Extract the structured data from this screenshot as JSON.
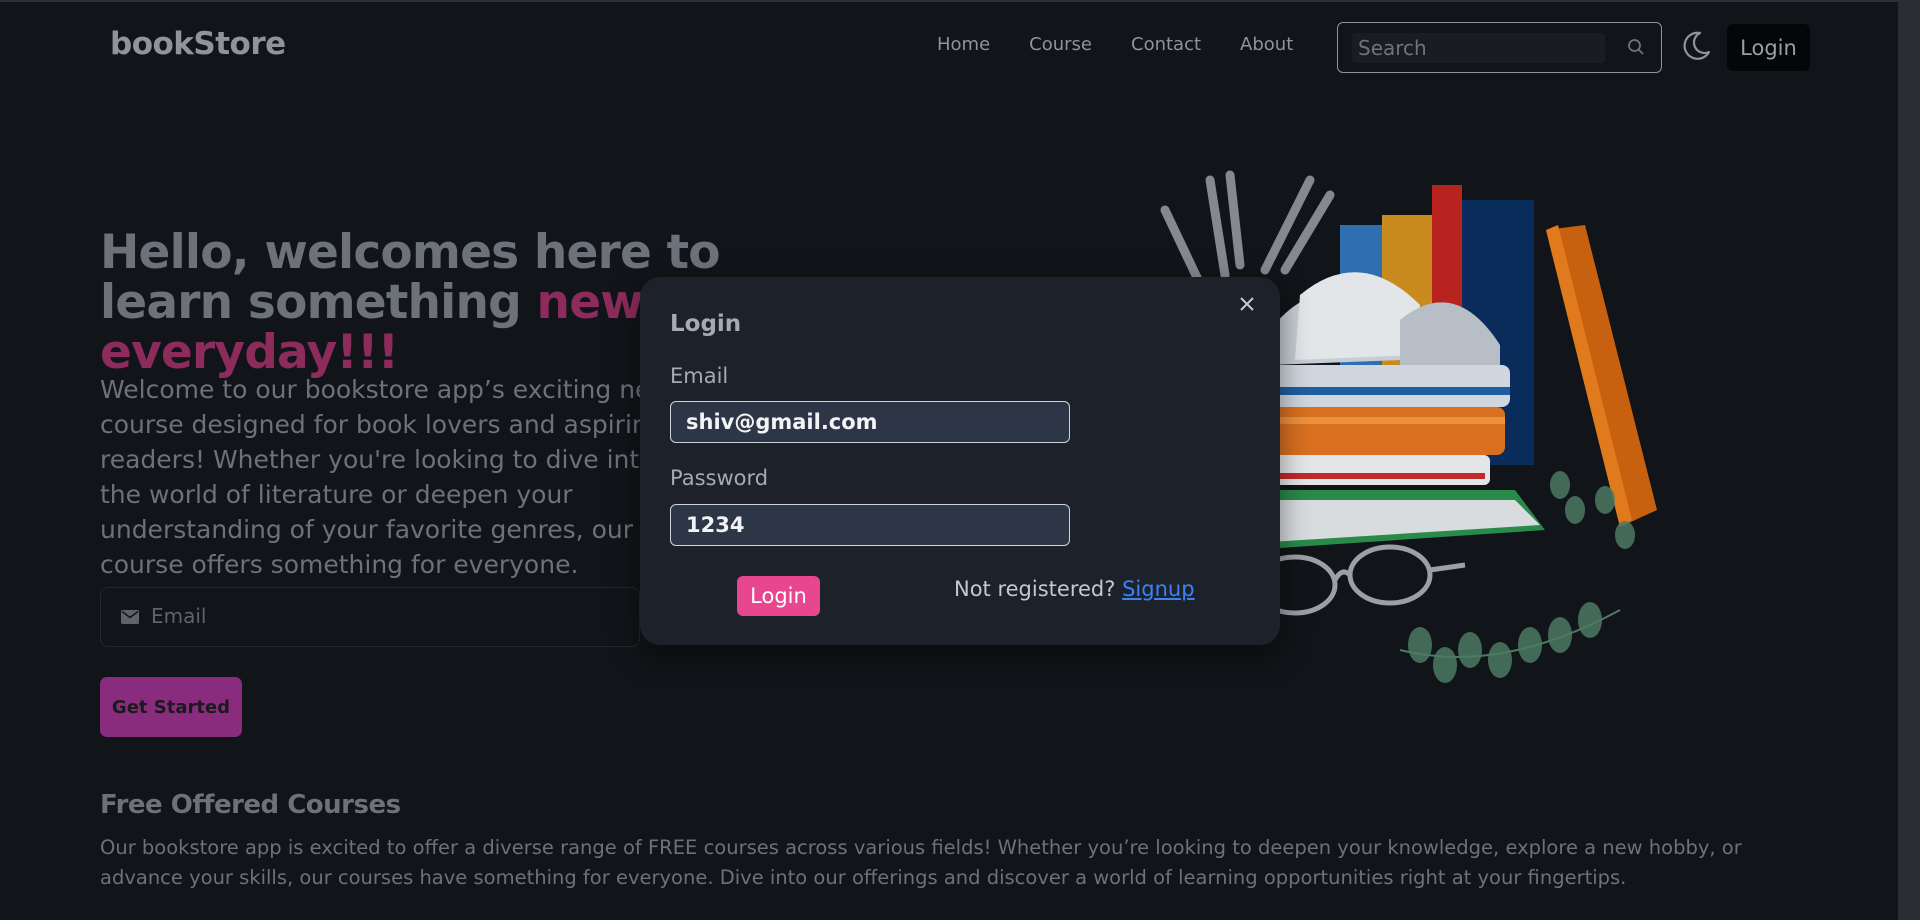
{
  "navbar": {
    "logo": "bookStore",
    "links": [
      "Home",
      "Course",
      "Contact",
      "About"
    ],
    "search_placeholder": "Search",
    "login_label": "Login"
  },
  "hero": {
    "title_start": "Hello, welcomes here to learn something ",
    "title_accent": "new everyday!!!",
    "paragraph": "Welcome to our bookstore app’s exciting new course designed for book lovers and aspiring readers! Whether you're looking to dive into the world of literature or deepen your understanding of your favorite genres, our course offers something for everyone.",
    "email_placeholder": "Email",
    "cta_label": "Get Started"
  },
  "courses": {
    "title": "Free Offered Courses",
    "text": "Our bookstore app is excited to offer a diverse range of FREE courses across various fields! Whether you’re looking to deepen your knowledge, explore a new hobby, or advance your skills, our courses have something for everyone. Dive into our offerings and discover a world of learning opportunities right at your fingertips."
  },
  "modal": {
    "title": "Login",
    "email_label": "Email",
    "email_value": "shiv@gmail.com",
    "password_label": "Password",
    "password_value": "1234",
    "login_label": "Login",
    "not_registered": "Not registered?",
    "signup_label": "Signup"
  },
  "colors": {
    "background": "#111418",
    "modal_bg": "#1c212a",
    "accent_pink": "#e8468e",
    "link_blue": "#3b82f6",
    "cta_purple": "#8a2c7d"
  },
  "icons": [
    "search-icon",
    "moon-icon",
    "mail-icon",
    "close-icon"
  ]
}
